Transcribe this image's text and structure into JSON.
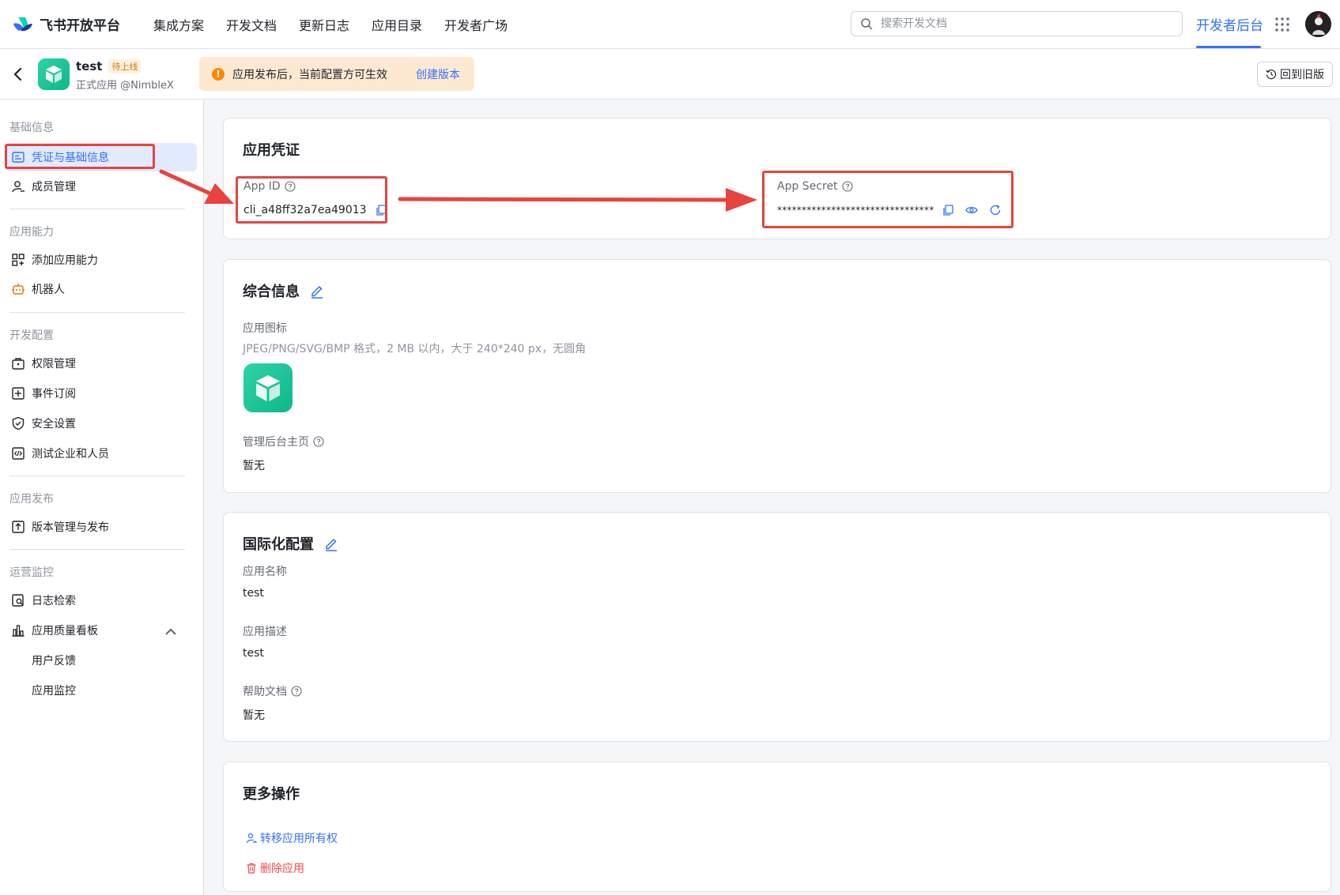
{
  "nav": {
    "logo_text": "飞书开放平台",
    "links": [
      "集成方案",
      "开发文档",
      "更新日志",
      "应用目录",
      "开发者广场"
    ],
    "search_placeholder": "搜索开发文档",
    "console": "开发者后台"
  },
  "app": {
    "name": "test",
    "badge": "待上线",
    "subtitle": "正式应用 @NimbleX",
    "notice": "应用发布后，当前配置方可生效",
    "notice_link": "创建版本",
    "old_version": "回到旧版"
  },
  "sidebar": {
    "groups": [
      "基础信息",
      "应用能力",
      "开发配置",
      "应用发布",
      "运营监控"
    ],
    "items": [
      "凭证与基础信息",
      "成员管理",
      "添加应用能力",
      "机器人",
      "权限管理",
      "事件订阅",
      "安全设置",
      "测试企业和人员",
      "版本管理与发布",
      "日志检索",
      "应用质量看板",
      "用户反馈",
      "应用监控"
    ]
  },
  "credentials": {
    "title": "应用凭证",
    "app_id_label": "App ID",
    "app_id": "cli_a48ff32a7ea49013",
    "app_secret_label": "App Secret",
    "app_secret": "********************************"
  },
  "general": {
    "title": "综合信息",
    "icon_label": "应用图标",
    "icon_hint": "JPEG/PNG/SVG/BMP 格式，2 MB 以内，大于 240*240 px，无圆角",
    "homepage_label": "管理后台主页",
    "homepage_value": "暂无"
  },
  "i18n": {
    "title": "国际化配置",
    "name_label": "应用名称",
    "name_value": "test",
    "desc_label": "应用描述",
    "desc_value": "test",
    "help_label": "帮助文档",
    "help_value": "暂无"
  },
  "more": {
    "title": "更多操作",
    "transfer": "转移应用所有权",
    "delete": "删除应用"
  },
  "colors": {
    "accent": "#3370ff",
    "annotation": "#e8433f",
    "danger": "#f54a45"
  }
}
